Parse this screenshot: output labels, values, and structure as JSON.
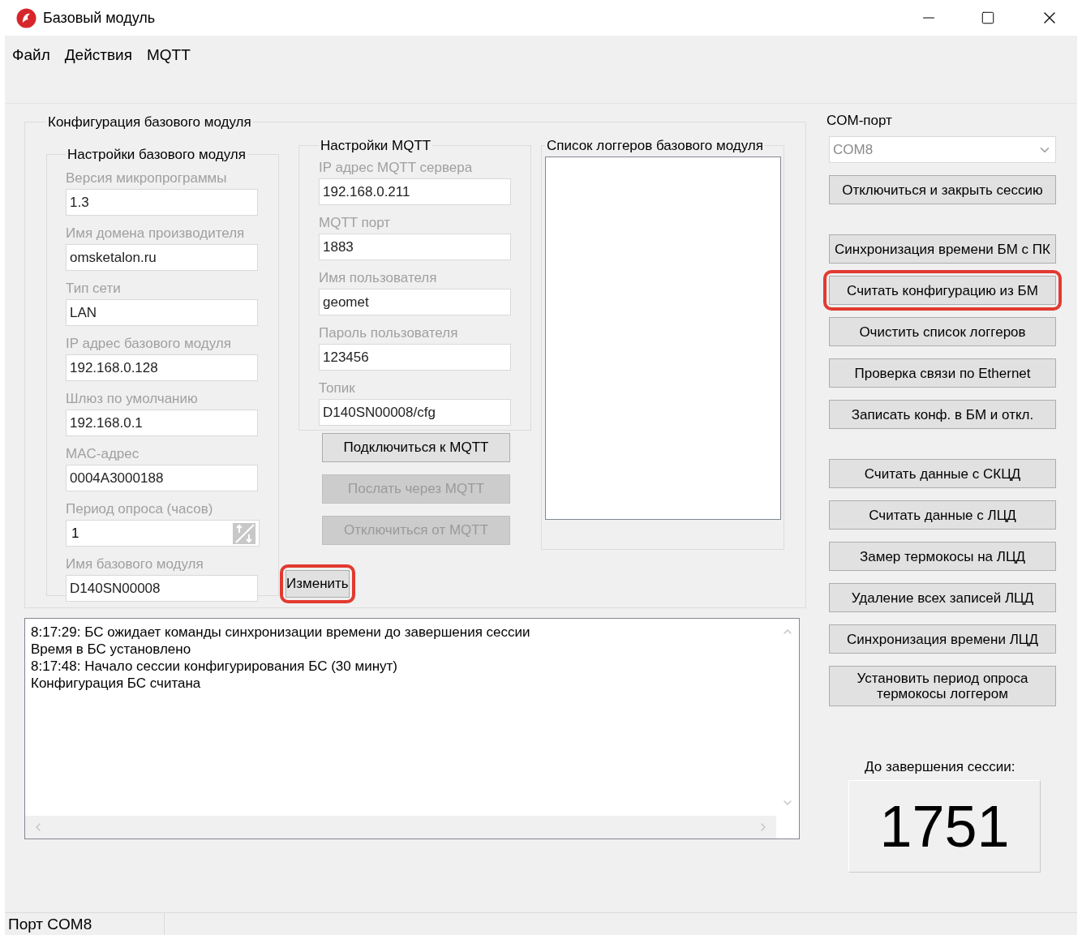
{
  "window": {
    "title": "Базовый модуль"
  },
  "menu": [
    "Файл",
    "Действия",
    "MQTT"
  ],
  "config": {
    "title": "Конфигурация базового модуля",
    "base_settings": {
      "title": "Настройки базового модуля",
      "fields": [
        {
          "label": "Версия микропрограммы",
          "value": "1.3",
          "kind": "text",
          "label_disabled": true
        },
        {
          "label": "Имя домена производителя",
          "value": "omsketalon.ru",
          "kind": "text",
          "label_disabled": true
        },
        {
          "label": "Тип сети",
          "value": "LAN",
          "kind": "text",
          "label_disabled": true
        },
        {
          "label": "IP адрес базового модуля",
          "value": "192.168.0.128",
          "kind": "text",
          "label_disabled": true
        },
        {
          "label": "Шлюз по умолчанию",
          "value": "192.168.0.1",
          "kind": "text",
          "label_disabled": true
        },
        {
          "label": "MAC-адрес",
          "value": "0004A3000188",
          "kind": "text",
          "label_disabled": true
        },
        {
          "label": "Период опроса (часов)",
          "value": "1",
          "kind": "spinner",
          "label_disabled": true
        },
        {
          "label": "Имя базового модуля",
          "value": "D140SN00008",
          "kind": "text",
          "label_disabled": true
        }
      ]
    },
    "mqtt_settings": {
      "title": "Настройки MQTT",
      "fields": [
        {
          "label": "IP адрес MQTT сервера",
          "value": "192.168.0.211",
          "kind": "text",
          "label_disabled": true
        },
        {
          "label": "MQTT порт",
          "value": "1883",
          "kind": "text",
          "label_disabled": true
        },
        {
          "label": "Имя пользователя",
          "value": "geomet",
          "kind": "text",
          "label_disabled": true
        },
        {
          "label": "Пароль пользователя",
          "value": "123456",
          "kind": "text",
          "label_disabled": true
        },
        {
          "label": "Топик",
          "value": "D140SN00008/cfg",
          "kind": "text",
          "label_disabled": true
        }
      ]
    },
    "mqtt_buttons": [
      {
        "label": "Подключиться к MQTT",
        "disabled": false
      },
      {
        "label": "Послать через MQTT",
        "disabled": true
      },
      {
        "label": "Отключиться от MQTT",
        "disabled": true
      }
    ],
    "edit_button": {
      "label": "Изменить",
      "highlighted": true
    },
    "loggers": {
      "title": "Список логгеров базового модуля"
    }
  },
  "log": {
    "lines": [
      "8:17:29: БС ожидает команды синхронизации времени до завершения сессии",
      "Время в БС установлено",
      "8:17:48: Начало сессии конфигурирования БС (30 минут)",
      "Конфигурация БС считана"
    ]
  },
  "com_port": {
    "label": "COM-порт",
    "value": "COM8",
    "disabled": true
  },
  "button_groups": [
    [
      {
        "label": "Отключиться и закрыть сессию",
        "highlighted": false
      }
    ],
    [
      {
        "label": "Синхронизация времени БМ с ПК",
        "highlighted": false
      },
      {
        "label": "Считать конфигурацию из БМ",
        "highlighted": true
      },
      {
        "label": "Очистить список логгеров",
        "highlighted": false
      },
      {
        "label": "Проверка связи по Ethernet",
        "highlighted": false
      },
      {
        "label": "Записать конф. в БМ и откл.",
        "highlighted": false
      }
    ],
    [
      {
        "label": "Считать данные с СКЦД",
        "highlighted": false
      },
      {
        "label": "Считать данные с ЛЦД",
        "highlighted": false
      },
      {
        "label": "Замер термокосы на ЛЦД",
        "highlighted": false
      },
      {
        "label": "Удаление всех записей ЛЦД",
        "highlighted": false
      },
      {
        "label": "Синхронизация времени ЛЦД",
        "highlighted": false
      },
      {
        "label": "Установить период опроса термокосы логгером",
        "highlighted": false
      }
    ]
  ],
  "session": {
    "label": "До завершения сессии:",
    "value": "1751"
  },
  "status_bar": [
    "Порт COM8"
  ]
}
